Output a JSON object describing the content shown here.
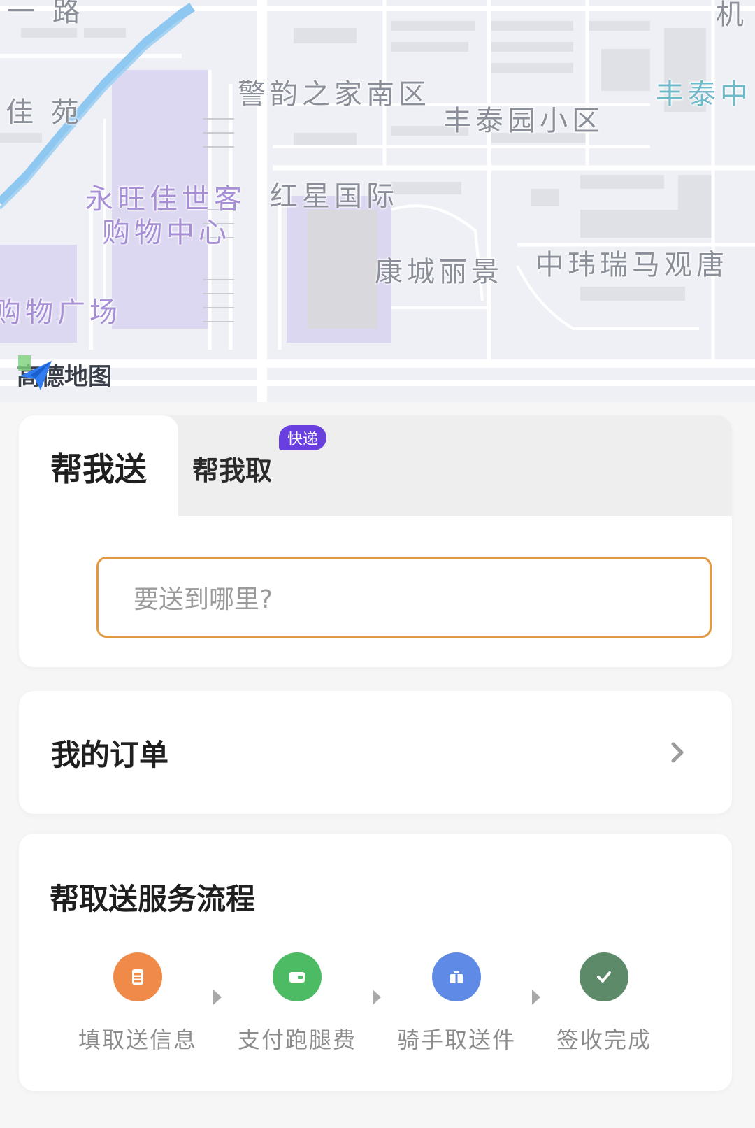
{
  "map": {
    "labels": [
      {
        "id": "road-top",
        "text": "一 路",
        "tone": "gray"
      },
      {
        "id": "jiayuan",
        "text": "佳 苑",
        "tone": "gray"
      },
      {
        "id": "jingyun",
        "text": "警韵之家南区",
        "tone": "gray"
      },
      {
        "id": "fengtaiyuan",
        "text": "丰泰园小区",
        "tone": "gray"
      },
      {
        "id": "fengtai-right",
        "text": "丰泰中",
        "tone": "teal"
      },
      {
        "id": "ji-right",
        "text": "机",
        "tone": "gray"
      },
      {
        "id": "yongwang-1",
        "text": "永旺佳世客",
        "tone": "purple"
      },
      {
        "id": "yongwang-2",
        "text": "购物中心",
        "tone": "purple"
      },
      {
        "id": "hongxing",
        "text": "红星国际",
        "tone": "gray"
      },
      {
        "id": "kangcheng",
        "text": "康城丽景",
        "tone": "gray"
      },
      {
        "id": "zhongwei",
        "text": "中玮瑞马观唐",
        "tone": "gray"
      },
      {
        "id": "gouwu",
        "text": "购物广场",
        "tone": "purple"
      }
    ],
    "logo_text": "高德地图"
  },
  "send_card": {
    "tab_send": "帮我送",
    "tab_fetch": "帮我取",
    "badge": "快递",
    "destination_placeholder": "要送到哪里?"
  },
  "orders": {
    "title": "我的订单"
  },
  "process": {
    "title": "帮取送服务流程",
    "steps": [
      {
        "label": "填取送信息",
        "icon": "document-icon",
        "color": "#ef8a49"
      },
      {
        "label": "支付跑腿费",
        "icon": "wallet-icon",
        "color": "#4cbb63"
      },
      {
        "label": "骑手取送件",
        "icon": "parcel-icon",
        "color": "#5f8ae6"
      },
      {
        "label": "签收完成",
        "icon": "check-icon",
        "color": "#5d8a68"
      }
    ]
  },
  "colors": {
    "accent_orange": "#e19a43",
    "badge_purple": "#6a3fe0",
    "map_bg": "#eef0f5"
  }
}
